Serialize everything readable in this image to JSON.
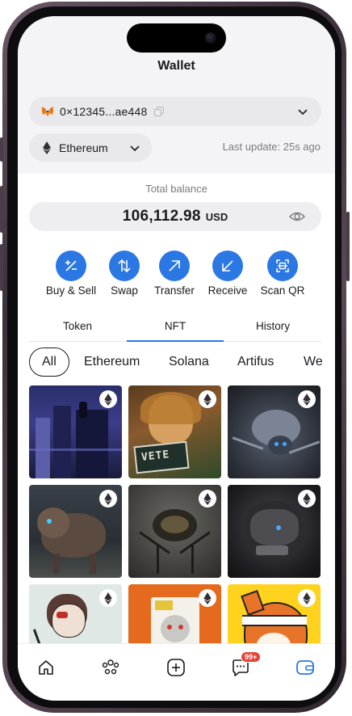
{
  "header": {
    "title": "Wallet"
  },
  "wallet": {
    "address": "0×12345...ae448"
  },
  "network": {
    "name": "Ethereum"
  },
  "status": {
    "last_update": "Last update: 25s ago"
  },
  "balance": {
    "label": "Total balance",
    "amount": "106,112.98",
    "currency": "USD"
  },
  "actions": [
    {
      "label": "Buy & Sell",
      "icon": "plus-minus-icon"
    },
    {
      "label": "Swap",
      "icon": "swap-arrows-icon"
    },
    {
      "label": "Transfer",
      "icon": "arrow-up-right-icon"
    },
    {
      "label": "Receive",
      "icon": "arrow-down-left-icon"
    },
    {
      "label": "Scan QR",
      "icon": "scan-qr-icon"
    }
  ],
  "tabs": {
    "items": [
      "Token",
      "NFT",
      "History"
    ],
    "active": "NFT"
  },
  "filters": {
    "items": [
      "All",
      "Ethereum",
      "Solana",
      "Artifus",
      "We"
    ],
    "active": "All"
  },
  "bottom_nav": {
    "messages_badge": "99+"
  },
  "colors": {
    "accent": "#2b78e4",
    "badge": "#e2463b"
  }
}
